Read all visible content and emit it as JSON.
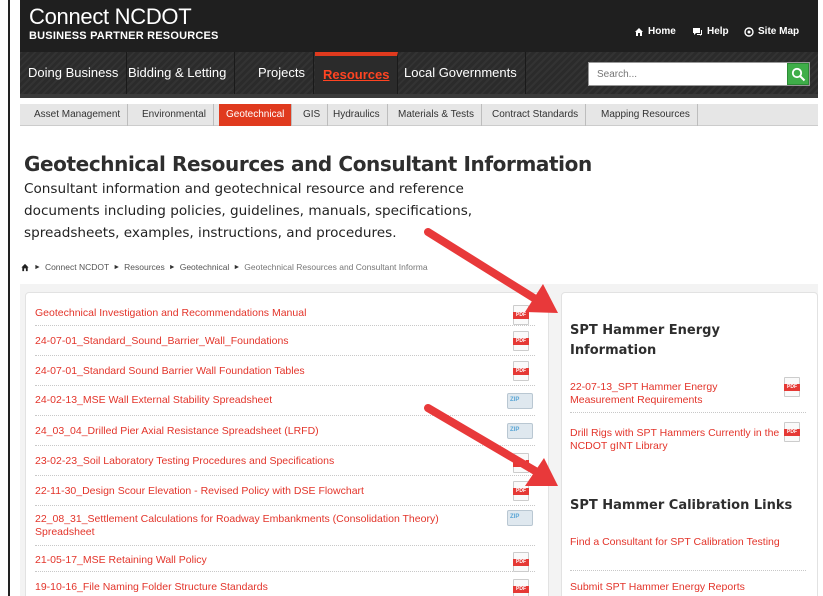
{
  "header": {
    "brand_title": "Connect NCDOT",
    "brand_sub": "BUSINESS PARTNER RESOURCES",
    "utility": [
      {
        "label": "Home",
        "icon": "home-icon"
      },
      {
        "label": "Help",
        "icon": "chat-icon"
      },
      {
        "label": "Site Map",
        "icon": "sitemap-icon"
      }
    ]
  },
  "nav": {
    "items": [
      "Doing Business",
      "Bidding & Letting",
      "Projects",
      "Resources",
      "Local Governments"
    ],
    "active": "Resources"
  },
  "search": {
    "placeholder": "Search..."
  },
  "subnav": {
    "items": [
      "Asset Management",
      "Environmental",
      "Geotechnical",
      "GIS",
      "Hydraulics",
      "Materials & Tests",
      "Contract Standards",
      "Mapping Resources"
    ],
    "active": "Geotechnical"
  },
  "page": {
    "title": "Geotechnical Resources and Consultant Information",
    "intro": "Consultant information and geotechnical resource and reference documents including policies, guidelines, manuals, specifications, spreadsheets, examples, instructions, and procedures."
  },
  "breadcrumb": [
    "Connect NCDOT",
    "Resources",
    "Geotechnical",
    "Geotechnical Resources and Consultant Informa"
  ],
  "documents": [
    {
      "label": "Geotechnical Investigation and Recommendations Manual",
      "type": "pdf"
    },
    {
      "label": "24-07-01_Standard_Sound_Barrier_Wall_Foundations",
      "type": "pdf"
    },
    {
      "label": "24-07-01_Standard Sound Barrier Wall Foundation Tables",
      "type": "pdf"
    },
    {
      "label": "24-02-13_MSE Wall External Stability Spreadsheet",
      "type": "zip"
    },
    {
      "label": "24_03_04_Drilled Pier Axial Resistance Spreadsheet (LRFD)",
      "type": "zip"
    },
    {
      "label": "23-02-23_Soil Laboratory Testing Procedures and Specifications",
      "type": "pdf"
    },
    {
      "label": "22-11-30_Design Scour Elevation - Revised Policy with DSE Flowchart",
      "type": "pdf"
    },
    {
      "label": "22_08_31_Settlement Calculations for Roadway Embankments (Consolidation Theory) Spreadsheet",
      "type": "zip"
    },
    {
      "label": "21-05-17_MSE Retaining Wall Policy",
      "type": "pdf"
    },
    {
      "label": "19-10-16_File Naming Folder Structure Standards",
      "type": "pdf"
    }
  ],
  "sidebar": {
    "energy_title": "SPT Hammer Energy Information",
    "energy_links": [
      {
        "label": "22-07-13_SPT Hammer Energy Measurement Requirements",
        "type": "pdf"
      },
      {
        "label": "Drill Rigs with SPT Hammers Currently in the NCDOT gINT Library",
        "type": "pdf"
      }
    ],
    "calibration_title": "SPT Hammer Calibration Links",
    "calibration_links": [
      {
        "label": "Find a Consultant for SPT Calibration Testing"
      },
      {
        "label": "Submit SPT Hammer Energy Reports"
      }
    ]
  },
  "colors": {
    "accent": "#e03a1e",
    "link": "#e3342a",
    "search_button": "#3fae49",
    "arrow": "#e8393a"
  }
}
